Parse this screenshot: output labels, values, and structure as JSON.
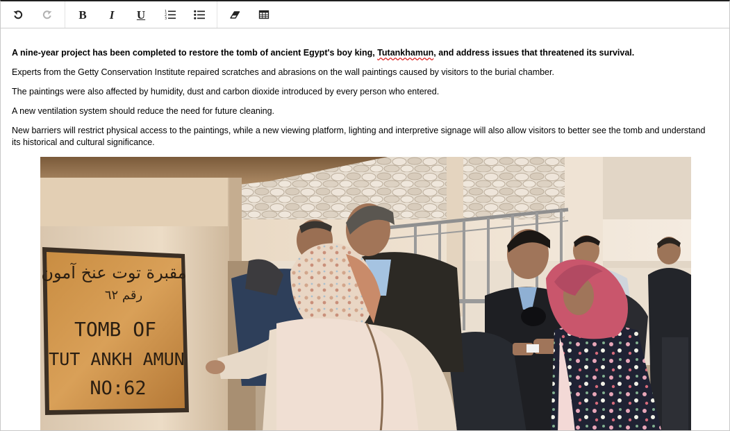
{
  "toolbar": {
    "undo": "Undo",
    "redo": "Redo",
    "bold": "B",
    "italic": "I",
    "underline": "U"
  },
  "article": {
    "lead_before": "A nine-year project has been completed to restore the tomb of ancient Egypt's boy king, ",
    "lead_misspelled": "Tutankhamun",
    "lead_after": ", and address issues that threatened its survival.",
    "paragraphs": [
      "Experts from the Getty Conservation Institute repaired scratches and abrasions on the wall paintings caused by visitors to the burial chamber.",
      "The paintings were also affected by humidity, dust and carbon dioxide introduced by every person who entered.",
      "A new ventilation system should reduce the need for future cleaning.",
      "New barriers will restrict physical access to the paintings, while a new viewing platform, lighting and interpretive signage will also allow visitors to better see the tomb and understand its historical and cultural significance."
    ]
  },
  "image": {
    "sign_arabic_1": "مقبرة توت عنخ آمون",
    "sign_arabic_2": "رقم ٦٢",
    "sign_line1": "TOMB OF",
    "sign_line2": "TUT ANKH AMUN",
    "sign_line3": "NO:62"
  }
}
